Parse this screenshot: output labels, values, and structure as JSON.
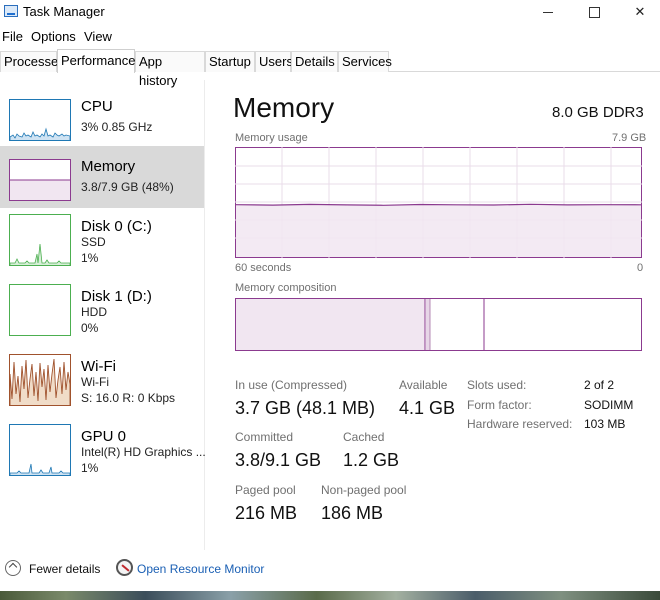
{
  "window": {
    "title": "Task Manager"
  },
  "menu": [
    "File",
    "Options",
    "View"
  ],
  "tabs": [
    "Processes",
    "Performance",
    "App history",
    "Startup",
    "Users",
    "Details",
    "Services"
  ],
  "active_tab": "Performance",
  "sidebar": {
    "items": [
      {
        "title": "CPU",
        "line2": "3% 0.85 GHz",
        "line3": "",
        "color": "#1f78b4"
      },
      {
        "title": "Memory",
        "line2": "3.8/7.9 GB (48%)",
        "line3": "",
        "color": "#8b3a8f"
      },
      {
        "title": "Disk 0 (C:)",
        "line2": "SSD",
        "line3": "1%",
        "color": "#4caf50"
      },
      {
        "title": "Disk 1 (D:)",
        "line2": "HDD",
        "line3": "0%",
        "color": "#4caf50"
      },
      {
        "title": "Wi-Fi",
        "line2": "Wi-Fi",
        "line3": "S: 16.0  R: 0 Kbps",
        "color": "#a0522d"
      },
      {
        "title": "GPU 0",
        "line2": "Intel(R) HD Graphics ...",
        "line3": "1%",
        "color": "#1f78b4"
      }
    ]
  },
  "main": {
    "title": "Memory",
    "spec": "8.0 GB DDR3",
    "usage_label": "Memory usage",
    "usage_max": "7.9 GB",
    "axis_left": "60 seconds",
    "axis_right": "0",
    "composition_label": "Memory composition",
    "usage_level": 0.48,
    "accent": "#8b3a8f",
    "stats": {
      "in_use_label": "In use (Compressed)",
      "in_use_value": "3.7 GB (48.1 MB)",
      "available_label": "Available",
      "available_value": "4.1 GB",
      "committed_label": "Committed",
      "committed_value": "3.8/9.1 GB",
      "cached_label": "Cached",
      "cached_value": "1.2 GB",
      "paged_label": "Paged pool",
      "paged_value": "216 MB",
      "nonpaged_label": "Non-paged pool",
      "nonpaged_value": "186 MB"
    },
    "details": [
      {
        "label": "Slots used:",
        "value": "2 of 2"
      },
      {
        "label": "Form factor:",
        "value": "SODIMM"
      },
      {
        "label": "Hardware reserved:",
        "value": "103 MB"
      }
    ]
  },
  "footer": {
    "fewer_details": "Fewer details",
    "resource_monitor": "Open Resource Monitor"
  }
}
